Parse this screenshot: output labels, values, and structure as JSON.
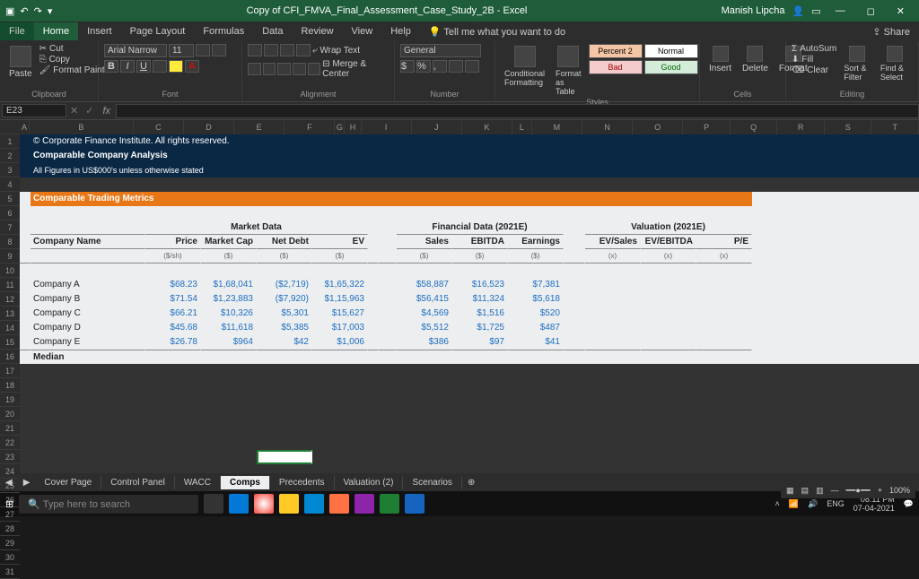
{
  "title": "Copy of CFI_FMVA_Final_Assessment_Case_Study_2B - Excel",
  "user": "Manish Lipcha",
  "tabs": {
    "file": "File",
    "home": "Home",
    "insert": "Insert",
    "pagelayout": "Page Layout",
    "formulas": "Formulas",
    "data": "Data",
    "review": "Review",
    "view": "View",
    "help": "Help",
    "tellme": "Tell me what you want to do",
    "share": "Share"
  },
  "ribbon": {
    "clipboard": {
      "label": "Clipboard",
      "paste": "Paste",
      "cut": "Cut",
      "copy": "Copy",
      "painter": "Format Painter"
    },
    "font": {
      "label": "Font",
      "name": "Arial Narrow",
      "size": "11"
    },
    "alignment": {
      "label": "Alignment",
      "wrap": "Wrap Text",
      "merge": "Merge & Center"
    },
    "number": {
      "label": "Number",
      "format": "General"
    },
    "styles": {
      "label": "Styles",
      "cond": "Conditional Formatting",
      "table": "Format as Table",
      "percent2": "Percent 2",
      "normal": "Normal",
      "bad": "Bad",
      "good": "Good"
    },
    "cells": {
      "label": "Cells",
      "insert": "Insert",
      "delete": "Delete",
      "format": "Format"
    },
    "editing": {
      "label": "Editing",
      "autosum": "AutoSum",
      "fill": "Fill",
      "clear": "Clear",
      "sort": "Sort & Filter",
      "find": "Find & Select"
    }
  },
  "namebox": "E23",
  "cols": [
    "A",
    "B",
    "C",
    "D",
    "E",
    "F",
    "G",
    "H",
    "I",
    "J",
    "K",
    "L",
    "M",
    "N",
    "O",
    "P",
    "Q",
    "R",
    "S",
    "T"
  ],
  "rows": 31,
  "r1": "© Corporate Finance Institute. All rights reserved.",
  "r2": "Comparable Company Analysis",
  "r3": "All Figures in US$000's unless otherwise stated",
  "r5": "Comparable Trading Metrics",
  "hdr": {
    "market": "Market Data",
    "fin": "Financial Data (2021E)",
    "val": "Valuation (2021E)"
  },
  "cols8": {
    "name": "Company Name",
    "price": "Price",
    "mcap": "Market Cap",
    "netdebt": "Net Debt",
    "ev": "EV",
    "sales": "Sales",
    "ebitda": "EBITDA",
    "earn": "Earnings",
    "evs": "EV/Sales",
    "eve": "EV/EBITDA",
    "pe": "P/E"
  },
  "unit": {
    "price": "($/sh)",
    "gen": "($)",
    "mult": "(x)"
  },
  "data": [
    {
      "n": "Company A",
      "p": "$68.23",
      "m": "$1,68,041",
      "d": "($2,719)",
      "e": "$1,65,322",
      "s": "$58,887",
      "eb": "$16,523",
      "ea": "$7,381"
    },
    {
      "n": "Company B",
      "p": "$71.54",
      "m": "$1,23,883",
      "d": "($7,920)",
      "e": "$1,15,963",
      "s": "$56,415",
      "eb": "$11,324",
      "ea": "$5,618"
    },
    {
      "n": "Company C",
      "p": "$66.21",
      "m": "$10,326",
      "d": "$5,301",
      "e": "$15,627",
      "s": "$4,569",
      "eb": "$1,516",
      "ea": "$520"
    },
    {
      "n": "Company D",
      "p": "$45.68",
      "m": "$11,618",
      "d": "$5,385",
      "e": "$17,003",
      "s": "$5,512",
      "eb": "$1,725",
      "ea": "$487"
    },
    {
      "n": "Company E",
      "p": "$26.78",
      "m": "$964",
      "d": "$42",
      "e": "$1,006",
      "s": "$386",
      "eb": "$97",
      "ea": "$41"
    }
  ],
  "median": "Median",
  "sheets": {
    "cover": "Cover Page",
    "cp": "Control Panel",
    "wacc": "WACC",
    "comps": "Comps",
    "prec": "Precedents",
    "val": "Valuation (2)",
    "scen": "Scenarios"
  },
  "zoom": "100%",
  "taskbar": {
    "search": "Type here to search",
    "time": "08:11 PM",
    "date": "07-04-2021",
    "lang": "ENG"
  }
}
